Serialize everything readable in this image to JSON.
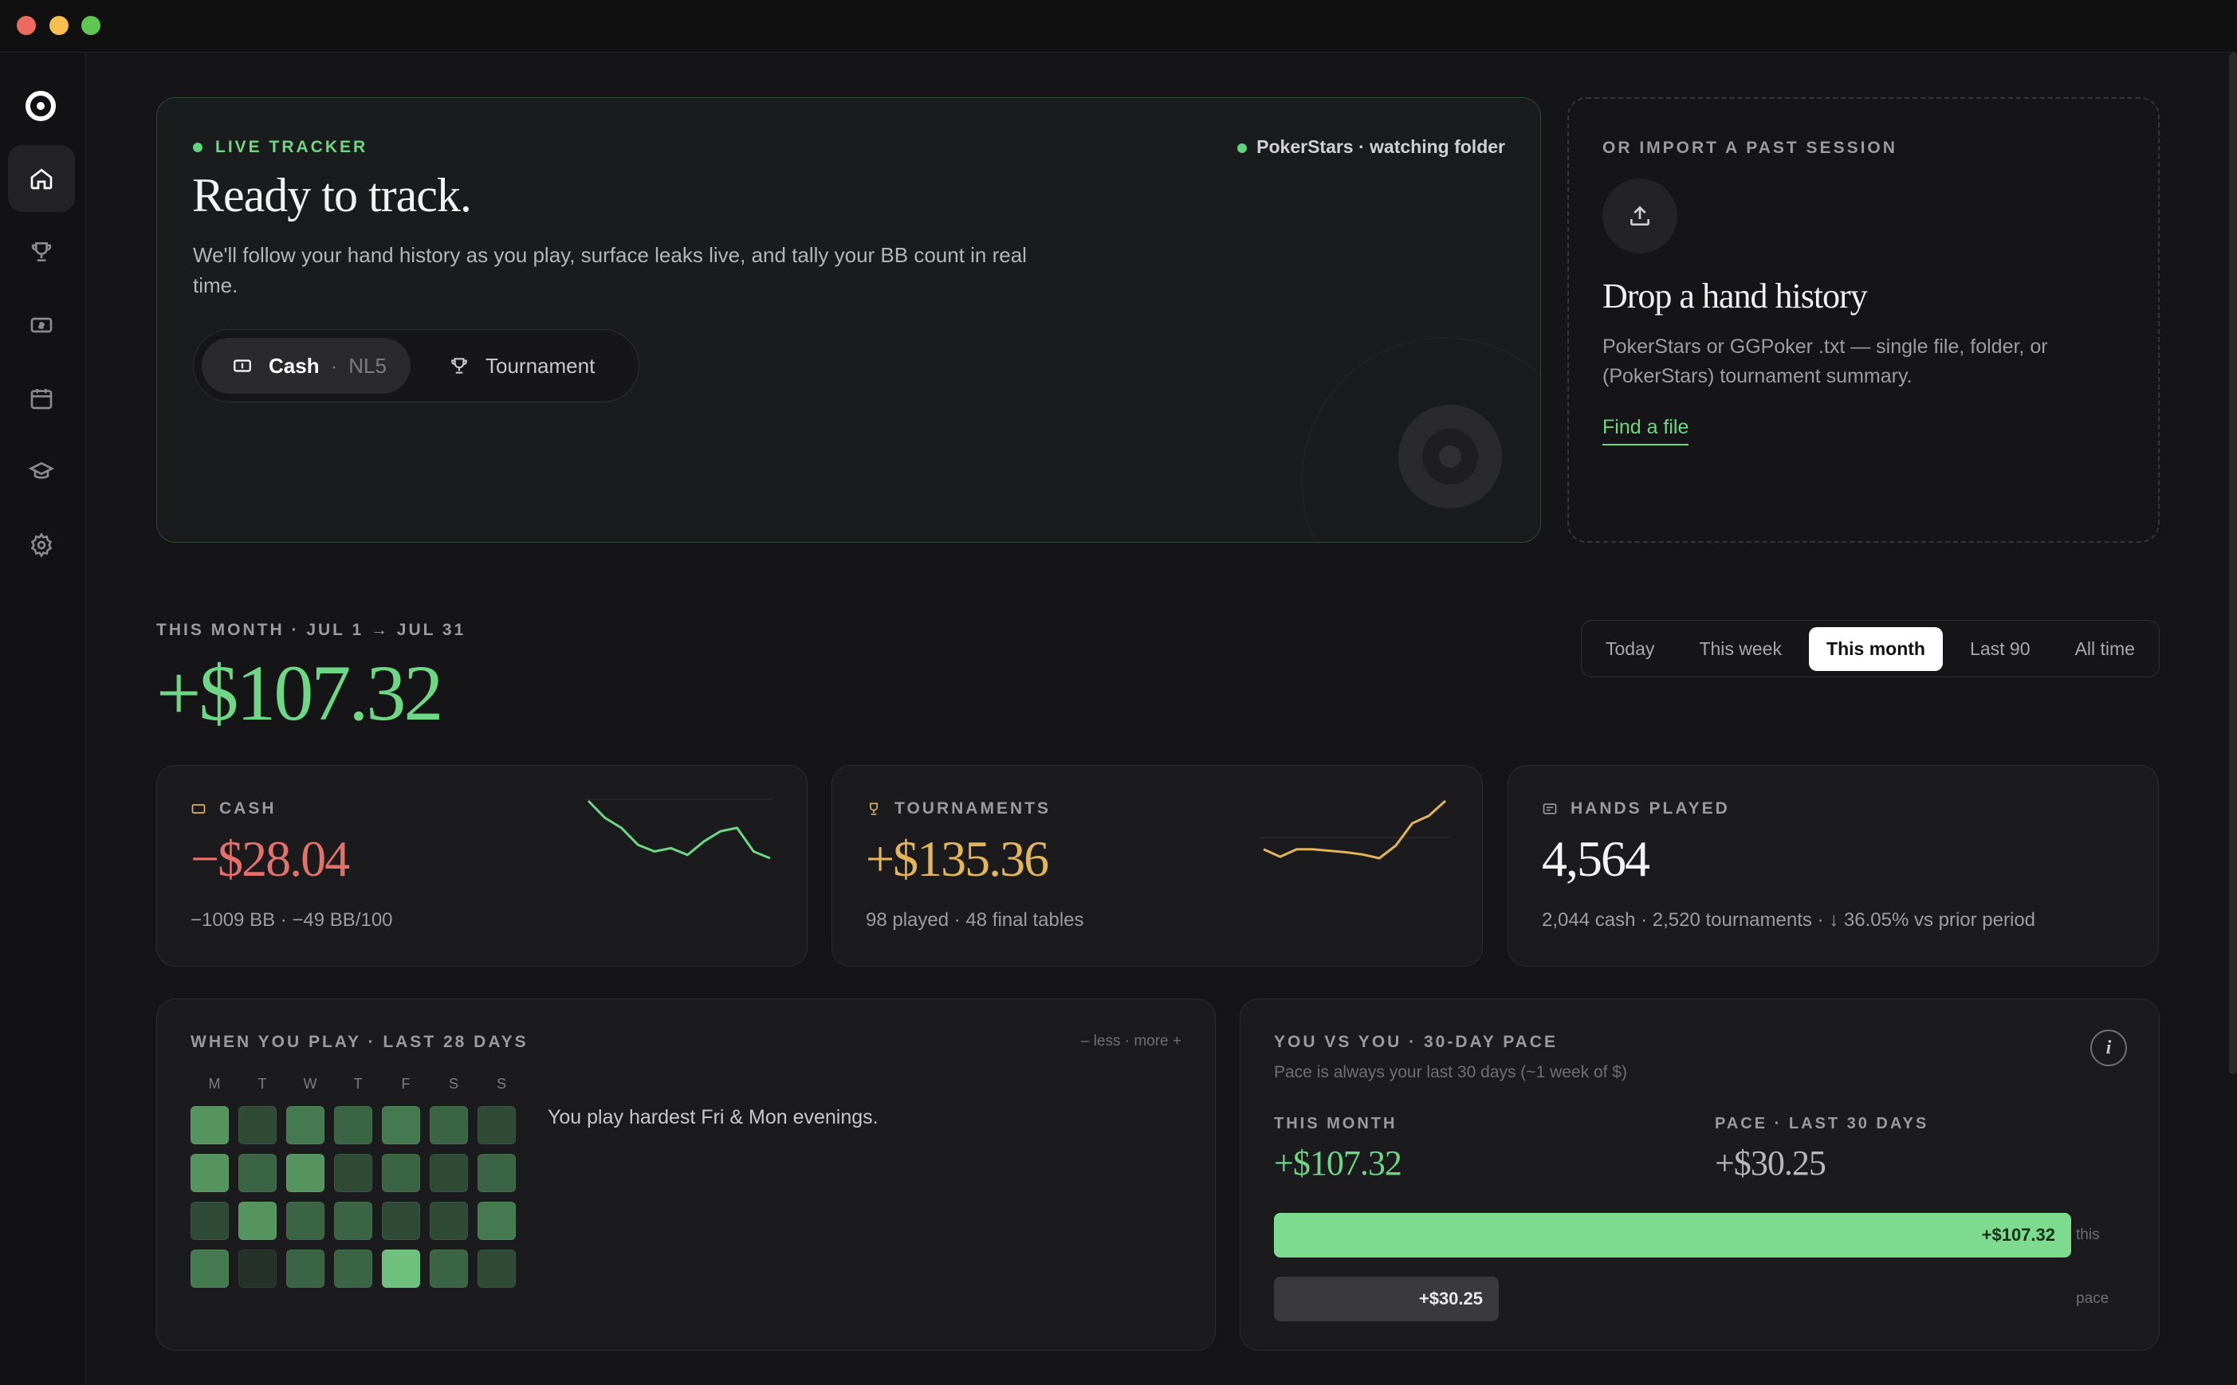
{
  "sidebar": {
    "items": [
      {
        "name": "home",
        "active": true
      },
      {
        "name": "tournaments",
        "active": false
      },
      {
        "name": "cash",
        "active": false
      },
      {
        "name": "calendar",
        "active": false
      },
      {
        "name": "study",
        "active": false
      },
      {
        "name": "settings",
        "active": false
      }
    ]
  },
  "live": {
    "tag": "LIVE TRACKER",
    "status": "PokerStars · watching folder",
    "title": "Ready to track.",
    "description": "We'll follow your hand history as you play, surface leaks live, and tally your BB count in real time.",
    "mode_cash": "Cash",
    "mode_cash_stake": "NL5",
    "mode_tournament": "Tournament"
  },
  "import": {
    "eyebrow": "OR IMPORT A PAST SESSION",
    "title": "Drop a hand history",
    "description": "PokerStars or GGPoker .txt — single file, folder, or (PokerStars) tournament summary.",
    "link": "Find a file"
  },
  "month": {
    "label": "THIS MONTH · JUL 1 → JUL 31",
    "total": "+$107.32"
  },
  "ranges": [
    "Today",
    "This week",
    "This month",
    "Last 90",
    "All time"
  ],
  "ranges_active": "This month",
  "stats": {
    "cash": {
      "label": "CASH",
      "value": "−$28.04",
      "foot": "−1009 BB · −49 BB/100",
      "color": "#e4706a",
      "spark_color": "#6ed785",
      "spark": [
        10,
        7.5,
        6,
        3.5,
        2.5,
        3,
        2,
        4,
        5.5,
        6,
        2.5,
        1.5
      ]
    },
    "tournaments": {
      "label": "TOURNAMENTS",
      "value": "+$135.36",
      "foot": "98 played · 48 final tables",
      "color": "#e2b55a",
      "spark_color": "#e2b55a",
      "spark": [
        3,
        2,
        3,
        3,
        2.8,
        2.6,
        2.3,
        1.8,
        3.5,
        6.5,
        7.5,
        9.5
      ]
    },
    "hands": {
      "label": "HANDS PLAYED",
      "value": "4,564",
      "foot": "2,044 cash · 2,520 tournaments · ↓ 36.05% vs prior period",
      "color": "#f2f2f2"
    }
  },
  "heatmap": {
    "title": "WHEN YOU PLAY · LAST 28 DAYS",
    "legend": "– less · more +",
    "days": [
      "M",
      "T",
      "W",
      "T",
      "F",
      "S",
      "S"
    ],
    "levels": [
      [
        4,
        1,
        3,
        2,
        3,
        2,
        1
      ],
      [
        4,
        2,
        4,
        1,
        2,
        1,
        2
      ],
      [
        1,
        4,
        2,
        2,
        1,
        1,
        3
      ],
      [
        3,
        0,
        2,
        2,
        5,
        2,
        1
      ]
    ],
    "insight": "You play hardest Fri & Mon evenings."
  },
  "pace": {
    "title": "YOU VS YOU · 30-DAY PACE",
    "subtitle": "Pace is always your last 30 days (~1 week of $)",
    "info": "i",
    "this_month_label": "THIS MONTH",
    "this_month_value": "+$107.32",
    "pace_label": "PACE · LAST 30 DAYS",
    "pace_value": "+$30.25",
    "bar_this_label": "+$107.32",
    "bar_this_fraction": 1.0,
    "bar_this_caption": "this",
    "bar_pace_label": "+$30.25",
    "bar_pace_fraction": 0.282,
    "bar_pace_caption": "pace"
  },
  "colors": {
    "accent_green": "#6ed785",
    "loss_red": "#e4706a",
    "gold": "#e2b55a"
  }
}
